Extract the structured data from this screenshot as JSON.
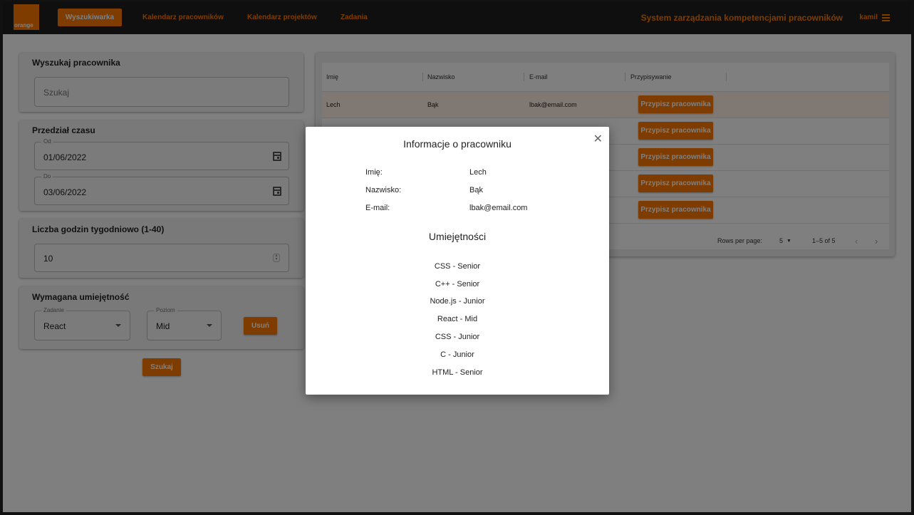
{
  "nav": {
    "logo": "orange",
    "active": "Wyszukiwarka",
    "links": [
      "Kalendarz pracowników",
      "Kalendarz projektów",
      "Zadania"
    ],
    "system_title": "System zarządzania kompetencjami pracowników",
    "user": "kamil"
  },
  "search_panel": {
    "title": "Wyszukaj pracownika",
    "placeholder": "Szukaj"
  },
  "date_panel": {
    "title": "Przedział czasu",
    "from_label": "Od",
    "from_value": "01/06/2022",
    "to_label": "Do",
    "to_value": "03/06/2022"
  },
  "hours_panel": {
    "title": "Liczba godzin tygodniowo (1-40)",
    "value": "10"
  },
  "skill_panel": {
    "title": "Wymagana umiejętność",
    "task_label": "Zadanie",
    "task_value": "React",
    "level_label": "Poziom",
    "level_value": "Mid",
    "remove_label": "Usuń"
  },
  "search_button": "Szukaj",
  "table": {
    "headers": [
      "Imię",
      "Nazwisko",
      "E-mail",
      "Przypisywanie"
    ],
    "row1": {
      "first": "Lech",
      "last": "Bąk",
      "email": "lbak@email.com"
    },
    "assign_label": "Przypisz pracownika",
    "rows_per_page_label": "Rows per page:",
    "rows_per_page_value": "5",
    "range": "1–5 of 5"
  },
  "modal": {
    "title": "Informacje o pracowniku",
    "labels": {
      "first": "Imię:",
      "last": "Nazwisko:",
      "email": "E-mail:"
    },
    "values": {
      "first": "Lech",
      "last": "Bąk",
      "email": "lbak@email.com"
    },
    "skills_title": "Umiejętności",
    "skills": [
      "CSS - Senior",
      "C++ - Senior",
      "Node.js - Junior",
      "React - Mid",
      "CSS - Junior",
      "C - Junior",
      "HTML - Senior"
    ]
  },
  "colors": {
    "accent": "#ff7900",
    "nav_bg": "#1e1e1e",
    "overlay": "rgba(0,0,0,0.5)"
  },
  "icons": [
    "calendar-icon",
    "chevron-down-icon",
    "close-icon",
    "menu-icon",
    "chevron-left-icon",
    "chevron-right-icon"
  ]
}
